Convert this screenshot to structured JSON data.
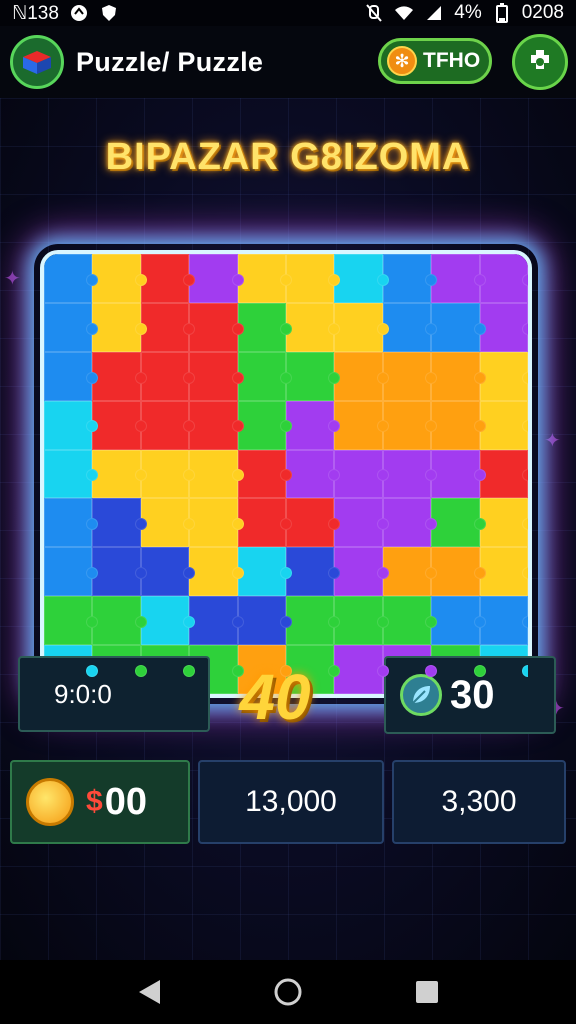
{
  "status_bar": {
    "time_left": "38",
    "battery": "4%",
    "clock": "0208",
    "left_glyph": "ℕ1"
  },
  "app_bar": {
    "title": "Puzzle/ Puzzle",
    "currency_label": "TFHO",
    "logo_icon": "puzzle-box-icon",
    "settings_icon": "puzzle-gear-icon"
  },
  "game": {
    "level_title": "BIPAZAR G8IZOMA",
    "board": {
      "columns": 10,
      "rows": 9,
      "palette": [
        "#1e8cf0",
        "#f02a2a",
        "#ffd020",
        "#ffa010",
        "#a23cf0",
        "#2ed13a",
        "#18d4f0",
        "#2a49d8"
      ]
    }
  },
  "stats": {
    "timer": "9:0:0",
    "score": "40",
    "moves": "30",
    "coins": "00",
    "coins_prefix": "$",
    "best": "13,000",
    "total": "3,300"
  },
  "nav": {
    "back_icon": "back-triangle-icon",
    "home_icon": "home-circle-icon",
    "recents_icon": "recents-square-icon"
  }
}
